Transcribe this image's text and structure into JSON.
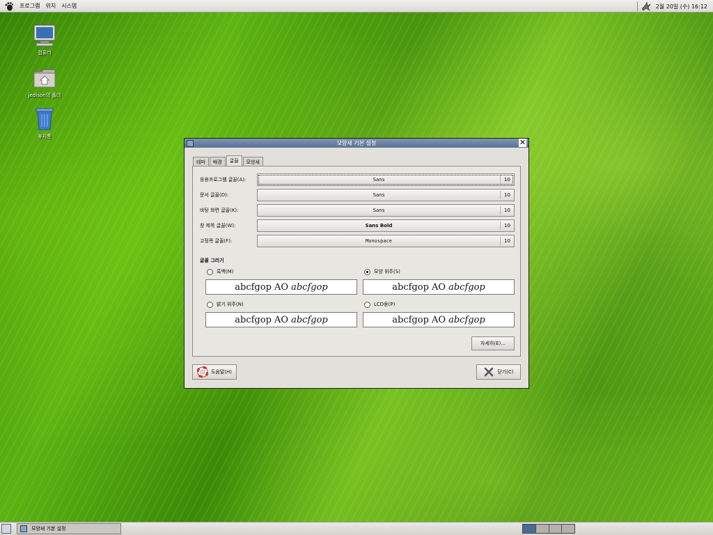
{
  "top_panel": {
    "menus": [
      "프로그램",
      "위치",
      "시스템"
    ],
    "clock": "2월 20일 (수) 16:12"
  },
  "desktop_icons": [
    {
      "label": "컴퓨터",
      "icon": "computer-icon"
    },
    {
      "label": "jedison의 폴더",
      "icon": "home-folder-icon"
    },
    {
      "label": "휴지통",
      "icon": "trash-icon"
    }
  ],
  "dialog": {
    "title": "모양새 기본 설정",
    "tabs": [
      "테마",
      "배경",
      "글꼴",
      "모양새"
    ],
    "active_tab": "글꼴",
    "fonts": [
      {
        "label": "응용프로그램 글꼴(A):",
        "font": "Sans",
        "size": "10",
        "style": "normal"
      },
      {
        "label": "문서 글꼴(D):",
        "font": "Sans",
        "size": "10",
        "style": "normal"
      },
      {
        "label": "바탕 화면 글꼴(K):",
        "font": "Sans",
        "size": "10",
        "style": "normal"
      },
      {
        "label": "창 제목 글꼴(W):",
        "font": "Sans Bold",
        "size": "10",
        "style": "bold"
      },
      {
        "label": "고정폭 글꼴(F):",
        "font": "Monospace",
        "size": "10",
        "style": "mono"
      }
    ],
    "rendering": {
      "title": "글꼴 그리기",
      "options": [
        {
          "label": "흑백(M)",
          "selected": false
        },
        {
          "label": "모양 위주(S)",
          "selected": true
        },
        {
          "label": "밝기 위주(N)",
          "selected": false
        },
        {
          "label": "LCD용(P)",
          "selected": false
        }
      ],
      "preview_regular": "abcfgop AO",
      "preview_italic": "abcfgop"
    },
    "details_button": "자세히(E)...",
    "help_button": "도움말(H)",
    "close_button": "닫기(C)"
  },
  "bottom_panel": {
    "task": "모양새 기본 설정",
    "workspaces": 4,
    "active_workspace": 1
  }
}
